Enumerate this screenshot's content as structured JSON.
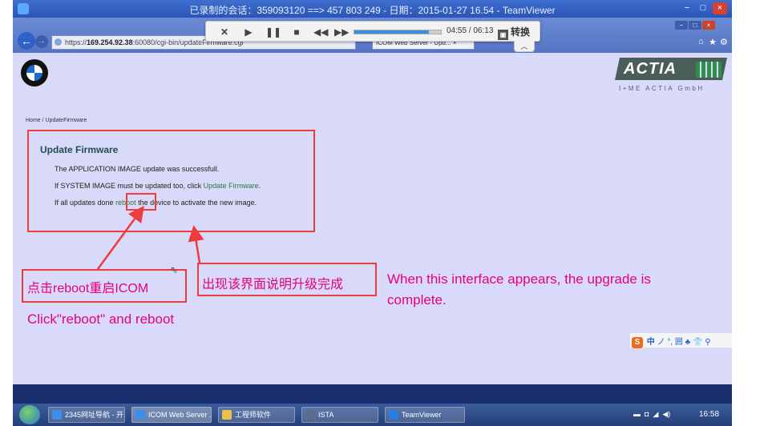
{
  "window": {
    "title": "已录制的会话：359093120 ==> 457 803 249 - 日期：2015-01-27 16.54 - TeamViewer",
    "controls": [
      "−",
      "□",
      "×"
    ]
  },
  "browser": {
    "url_prefix": "https://",
    "url_host": "169.254.92.38",
    "url_rest": ":60080/cgi-bin/updateFirmware.cgi",
    "tab_label": "ICOM Web Server - Upd... ×",
    "back_icon": "back-arrow-icon",
    "forward_icon": "forward-arrow-icon"
  },
  "player": {
    "progress": 0.86,
    "time": "04:55 / 06:13",
    "convert_label": "转换",
    "accent": "#3d8fe0"
  },
  "page": {
    "actia_logo": "ACTIA",
    "actia_subtitle": "I+ME ACTIA GmbH",
    "breadcrumb": "Home / UpdateFirmware",
    "heading": "Update Firmware",
    "line1": "The APPLICATION IMAGE update was successfull.",
    "line2_prefix": "If SYSTEM IMAGE must be updated too, click ",
    "line2_link": "Update Firmware",
    "line2_suffix": ".",
    "line3_prefix": "If all updates done ",
    "line3_link": "reboot",
    "line3_suffix": " the device to activate the new image."
  },
  "annotations": {
    "cn_click": "点击reboot重启ICOM",
    "cn_complete": "出现该界面说明升级完成",
    "en_complete_line1": "When this interface appears, the upgrade is",
    "en_complete_line2": "complete.",
    "en_click": "Click\"reboot\" and reboot",
    "color": "#e6007e",
    "box_color": "#ef3b3b"
  },
  "ime": {
    "label": "中",
    "symbols": "ノ °, 囲 ♣ 👕 ⚲"
  },
  "taskbar": {
    "items": [
      {
        "label": "2345网址导航 - 开..."
      },
      {
        "label": "ICOM Web Server ..."
      },
      {
        "label": "工程师软件"
      },
      {
        "label": "ISTA"
      },
      {
        "label": "TeamViewer"
      }
    ],
    "clock": "16:58"
  }
}
